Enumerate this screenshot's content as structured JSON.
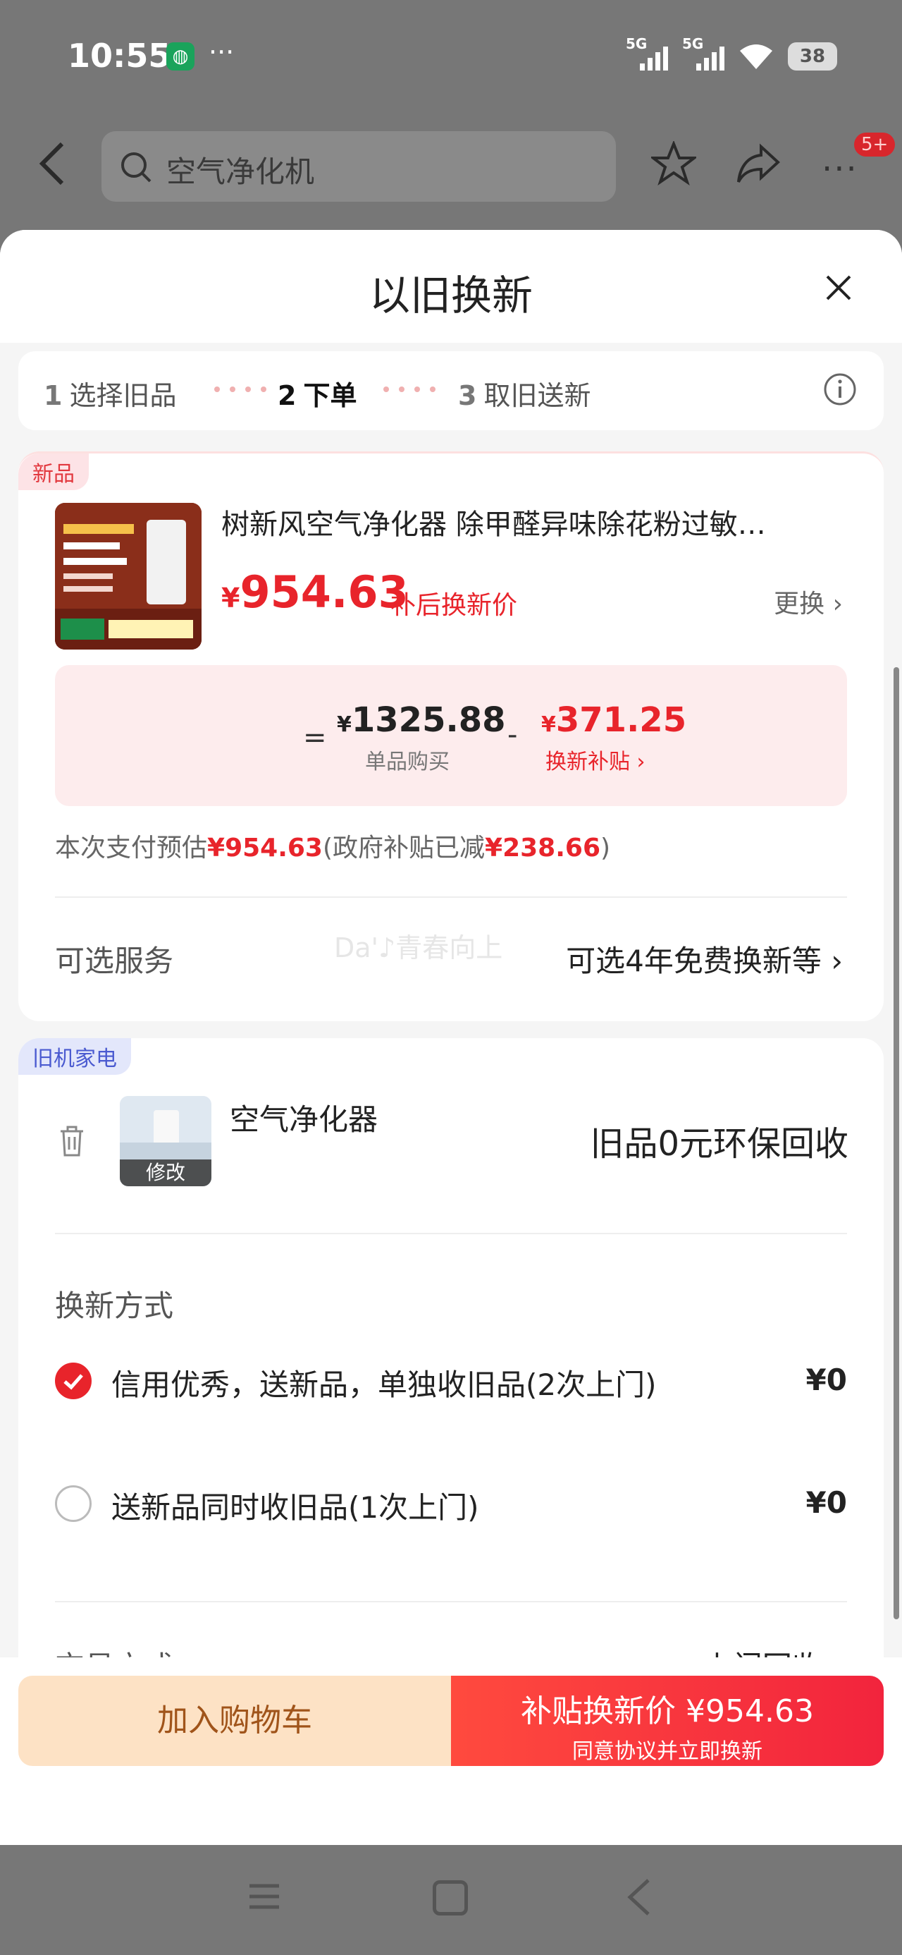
{
  "status_bar": {
    "time": "10:55",
    "dots": "···",
    "network1": "5G",
    "network2": "5G",
    "battery": "38"
  },
  "header": {
    "search_placeholder": "空气净化机",
    "badge": "5+",
    "more": "···"
  },
  "sheet": {
    "title": "以旧换新"
  },
  "steps": [
    {
      "num": "1",
      "label": "选择旧品"
    },
    {
      "num": "2",
      "label": "下单"
    },
    {
      "num": "3",
      "label": "取旧送新"
    }
  ],
  "new_product": {
    "tag": "新品",
    "title": "树新风空气净化器 除甲醛异味除花粉过敏…",
    "price_symbol": "¥",
    "price": "954.63",
    "price_label": "补后换新价",
    "change_label": "更换 ›",
    "calc": {
      "eq": "=",
      "base_symbol": "¥",
      "base_price": "1325.88",
      "base_label": "单品购买",
      "minus": "-",
      "sub_symbol": "¥",
      "sub_price": "371.25",
      "sub_label": "换新补贴 ›"
    },
    "estimate_prefix": "本次支付预估",
    "estimate_amount": "¥954.63",
    "estimate_mid": "(政府补贴已减",
    "estimate_gov": "¥238.66",
    "estimate_suffix": ")",
    "service_label": "可选服务",
    "service_value": "可选4年免费换新等 ›",
    "watermark": "Da'♪青春向上"
  },
  "old_product": {
    "tag": "旧机家电",
    "name": "空气净化器",
    "edit_label": "修改",
    "recycle": "旧品0元环保回收",
    "method_label": "换新方式",
    "options": [
      {
        "label": "信用优秀，送新品，单独收旧品(2次上门)",
        "price": "¥0",
        "selected": true
      },
      {
        "label": "送新品同时收旧品(1次上门)",
        "price": "¥0",
        "selected": false
      }
    ],
    "trade_label": "交易方式",
    "trade_value": "上门回收 ›"
  },
  "bottom": {
    "cart_label": "加入购物车",
    "buy_label": "补贴换新价 ¥954.63",
    "buy_sub": "同意协议并立即换新"
  },
  "colors": {
    "accent": "#e8242b",
    "cart_bg": "#fde2c5",
    "cart_text": "#a0541a"
  }
}
